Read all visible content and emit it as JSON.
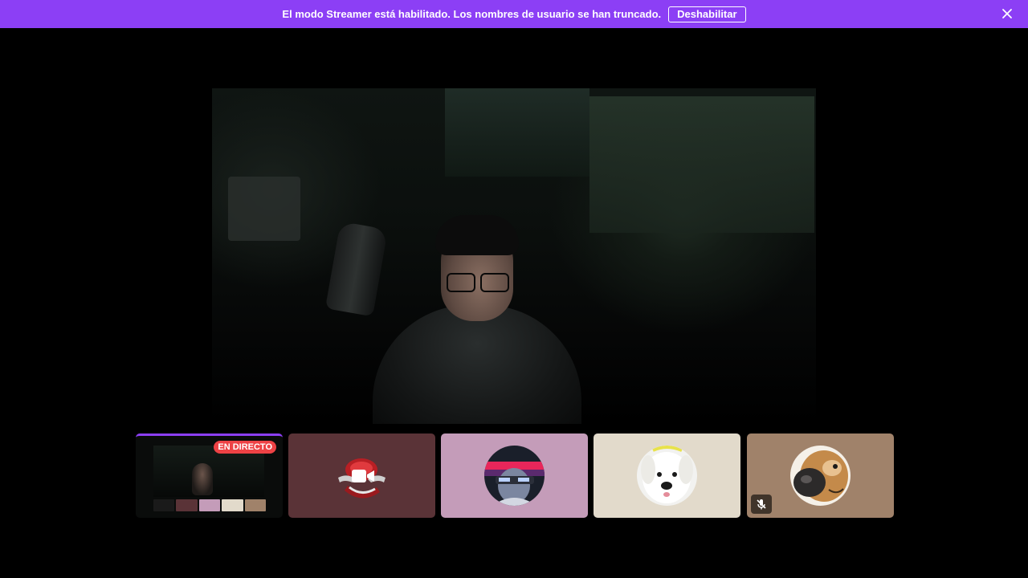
{
  "banner": {
    "message": "El modo Streamer está habilitado. Los nombres de usuario se han truncado.",
    "disable_label": "Deshabilitar",
    "close_icon": "close-icon"
  },
  "colors": {
    "banner": "#8c3ff5",
    "live": "#ed4245",
    "background": "#000000"
  },
  "stream": {
    "live_label": "EN DIRECTO"
  },
  "participants": [
    {
      "name": "participant-1",
      "tile_color": "#5a3337",
      "avatar": "red-robot-avatar",
      "icon": "camera-icon"
    },
    {
      "name": "participant-2",
      "tile_color": "#c49cb9",
      "avatar": "neon-character-avatar"
    },
    {
      "name": "participant-3",
      "tile_color": "#e2dacb",
      "avatar": "white-dog-avatar"
    },
    {
      "name": "participant-4",
      "tile_color": "#a0826a",
      "avatar": "brown-dog-avatar",
      "icon": "mic-muted-icon"
    }
  ]
}
